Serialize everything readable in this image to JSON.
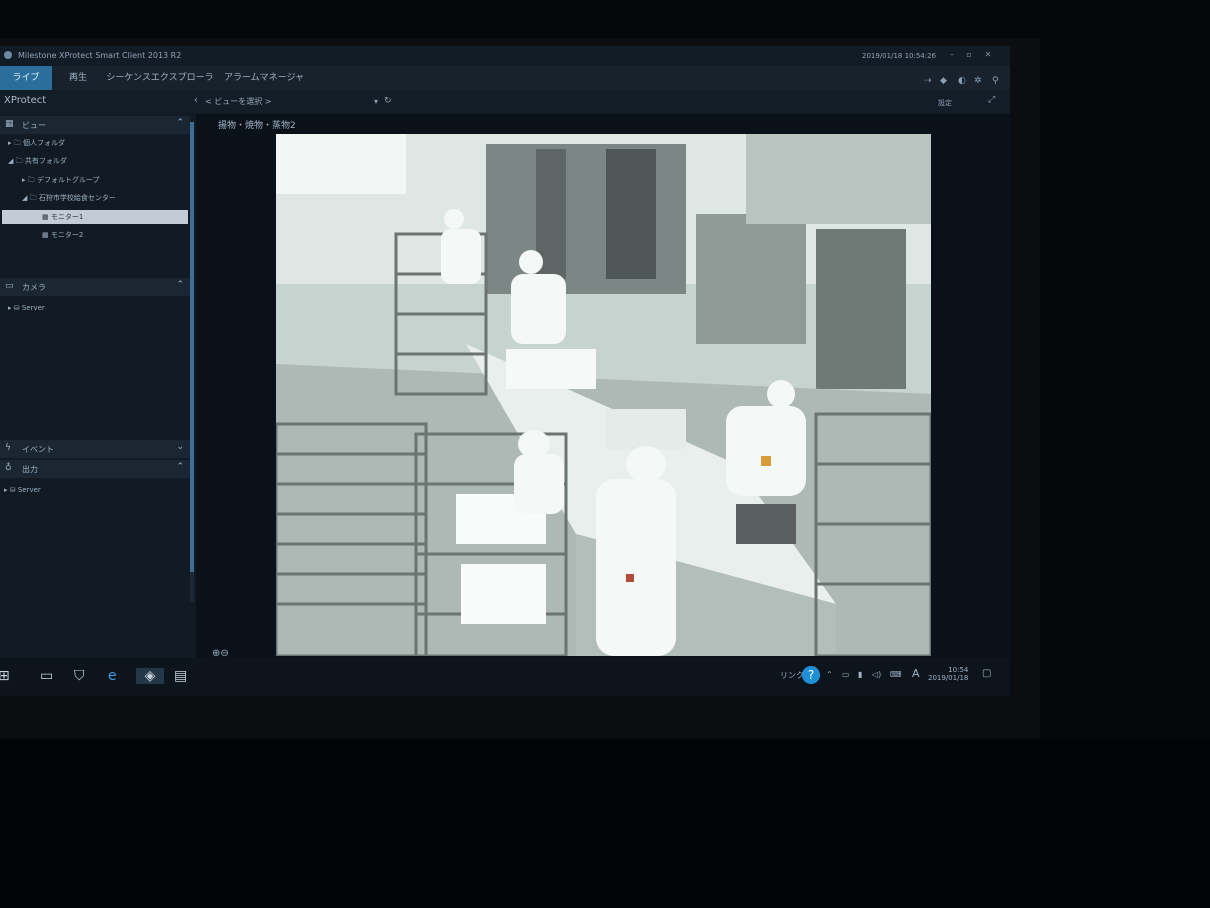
{
  "window": {
    "title": "Milestone XProtect Smart Client 2013 R2",
    "clock": "2019/01/18 10:54:26"
  },
  "tabs": [
    {
      "label": "ライブ",
      "active": true
    },
    {
      "label": "再生",
      "active": false
    },
    {
      "label": "シーケンスエクスプローラ",
      "active": false
    },
    {
      "label": "アラームマネージャ",
      "active": false
    }
  ],
  "header": {
    "app_name": "XProtect",
    "view_select": "< ビューを選択 >",
    "setup_label": "設定"
  },
  "views_panel": {
    "title": "ビュー",
    "items": [
      {
        "label": "個人フォルダ",
        "level": 0
      },
      {
        "label": "共有フォルダ",
        "level": 0
      },
      {
        "label": "デフォルトグループ",
        "level": 1
      },
      {
        "label": "石狩市学校給食センター",
        "level": 1
      },
      {
        "label": "モニター1",
        "level": 2,
        "selected": true
      },
      {
        "label": "モニター2",
        "level": 2
      }
    ]
  },
  "camera_panel": {
    "title": "カメラ",
    "items": [
      {
        "label": "Server"
      }
    ]
  },
  "event_panel": {
    "title": "イベント"
  },
  "output_panel": {
    "title": "出力",
    "items": [
      {
        "label": "Server"
      }
    ]
  },
  "camera_view": {
    "title": "揚物・焼物・蒸物2"
  },
  "taskbar": {
    "link_label": "リンク",
    "time": "10:54",
    "date": "2019/01/18",
    "ime": "A"
  },
  "colors": {
    "accent": "#2a6f9c",
    "help": "#1f8fd8",
    "background": "#0f1a24"
  }
}
